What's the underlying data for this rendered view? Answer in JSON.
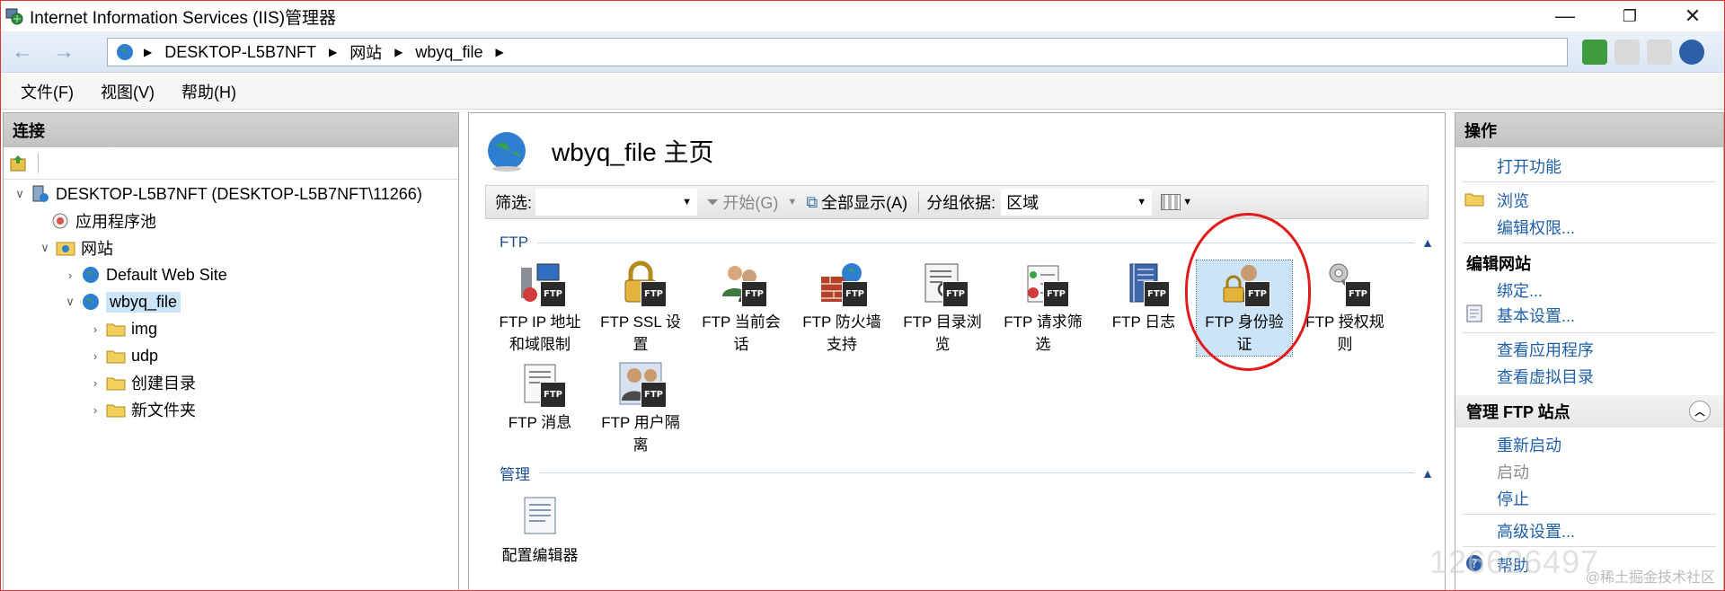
{
  "window": {
    "title": "Internet Information Services (IIS)管理器",
    "controls": {
      "minimize": "—",
      "maximize": "❐",
      "close": "✕"
    }
  },
  "address": {
    "crumbs": [
      "DESKTOP-L5B7NFT",
      "网站",
      "wbyq_file"
    ]
  },
  "menu": [
    "文件(F)",
    "视图(V)",
    "帮助(H)"
  ],
  "connections": {
    "header": "连接",
    "tree": [
      {
        "label": "DESKTOP-L5B7NFT (DESKTOP-L5B7NFT\\11266)",
        "icon": "server-icon",
        "expanded": true
      },
      {
        "label": "应用程序池",
        "icon": "app-pool-icon"
      },
      {
        "label": "网站",
        "icon": "sites-folder-icon",
        "expanded": true
      },
      {
        "label": "Default Web Site",
        "icon": "globe-icon"
      },
      {
        "label": "wbyq_file",
        "icon": "globe-icon",
        "selected": true,
        "expanded": true
      },
      {
        "label": "img",
        "icon": "folder-icon"
      },
      {
        "label": "udp",
        "icon": "folder-icon"
      },
      {
        "label": "创建目录",
        "icon": "folder-icon"
      },
      {
        "label": "新文件夹",
        "icon": "folder-icon"
      }
    ]
  },
  "main": {
    "title": "wbyq_file 主页",
    "filter": {
      "label": "筛选:",
      "value": "",
      "start": "开始(G)",
      "show_all": "全部显示(A)",
      "group_by_label": "分组依据:",
      "group_by_value": "区域"
    },
    "sections": [
      {
        "title": "FTP"
      },
      {
        "title": "管理"
      }
    ],
    "ftp_features": [
      {
        "line1": "FTP IP 地址",
        "line2": "和域限制",
        "icon": "ip-restriction-icon"
      },
      {
        "line1": "FTP SSL 设",
        "line2": "置",
        "icon": "ssl-lock-icon"
      },
      {
        "line1": "FTP 当前会",
        "line2": "话",
        "icon": "sessions-icon"
      },
      {
        "line1": "FTP 防火墙",
        "line2": "支持",
        "icon": "firewall-icon"
      },
      {
        "line1": "FTP 目录浏",
        "line2": "览",
        "icon": "directory-browse-icon"
      },
      {
        "line1": "FTP 请求筛",
        "line2": "选",
        "icon": "request-filter-icon"
      },
      {
        "line1": "FTP 日志",
        "line2": "",
        "icon": "log-icon"
      },
      {
        "line1": "FTP 身份验",
        "line2": "证",
        "icon": "authentication-icon",
        "selected": true
      },
      {
        "line1": "FTP 授权规",
        "line2": "则",
        "icon": "authorization-key-icon"
      },
      {
        "line1": "FTP 消息",
        "line2": "",
        "icon": "message-icon"
      },
      {
        "line1": "FTP 用户隔",
        "line2": "离",
        "icon": "user-isolation-icon"
      }
    ],
    "manage_features": [
      {
        "line1": "配置编辑器",
        "line2": "",
        "icon": "config-editor-icon"
      }
    ]
  },
  "actions": {
    "header": "操作",
    "open_feature": "打开功能",
    "browse": "浏览",
    "edit_permissions": "编辑权限...",
    "edit_site_group": "编辑网站",
    "bindings": "绑定...",
    "basic_settings": "基本设置...",
    "view_apps": "查看应用程序",
    "view_vdirs": "查看虚拟目录",
    "manage_ftp_group": "管理 FTP 站点",
    "restart": "重新启动",
    "start": "启动",
    "stop": "停止",
    "advanced": "高级设置...",
    "help": "帮助"
  },
  "watermark": "@稀土掘金技术社区",
  "watermark_overlay": "126626497",
  "colors": {
    "link": "#1f5fa8",
    "selection": "#cce4f7",
    "annotation": "#e01b1b"
  }
}
